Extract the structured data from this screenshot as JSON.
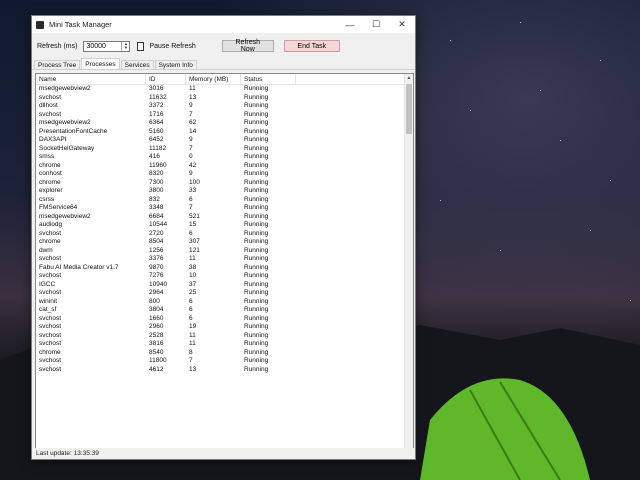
{
  "window": {
    "title": "Mini Task Manager",
    "minimize_glyph": "—",
    "maximize_glyph": "☐",
    "close_glyph": "✕"
  },
  "toolbar": {
    "refresh_label": "Refresh (ms)",
    "refresh_value": "30000",
    "pause_label": "Pause Refresh",
    "refresh_now_label": "Refresh Now",
    "end_task_label": "End Task"
  },
  "tabs": [
    {
      "label": "Process Tree"
    },
    {
      "label": "Processes"
    },
    {
      "label": "Services"
    },
    {
      "label": "System Info"
    }
  ],
  "columns": {
    "name": "Name",
    "id": "ID",
    "memory": "Memory (MB)",
    "status": "Status"
  },
  "rows": [
    {
      "name": "msedgewebview2",
      "id": "3016",
      "memory": "11",
      "status": "Running"
    },
    {
      "name": "svchost",
      "id": "11632",
      "memory": "13",
      "status": "Running"
    },
    {
      "name": "dllhost",
      "id": "3372",
      "memory": "9",
      "status": "Running"
    },
    {
      "name": "svchost",
      "id": "1716",
      "memory": "7",
      "status": "Running"
    },
    {
      "name": "msedgewebview2",
      "id": "6364",
      "memory": "62",
      "status": "Running"
    },
    {
      "name": "PresentationFontCache",
      "id": "5160",
      "memory": "14",
      "status": "Running"
    },
    {
      "name": "DAX3API",
      "id": "6452",
      "memory": "9",
      "status": "Running"
    },
    {
      "name": "SocketHelGateway",
      "id": "11182",
      "memory": "7",
      "status": "Running"
    },
    {
      "name": "smss",
      "id": "416",
      "memory": "0",
      "status": "Running"
    },
    {
      "name": "chrome",
      "id": "11960",
      "memory": "42",
      "status": "Running"
    },
    {
      "name": "conhost",
      "id": "8320",
      "memory": "9",
      "status": "Running"
    },
    {
      "name": "chrome",
      "id": "7300",
      "memory": "100",
      "status": "Running"
    },
    {
      "name": "explorer",
      "id": "3800",
      "memory": "33",
      "status": "Running"
    },
    {
      "name": "csrss",
      "id": "832",
      "memory": "6",
      "status": "Running"
    },
    {
      "name": "FMService64",
      "id": "3348",
      "memory": "7",
      "status": "Running"
    },
    {
      "name": "msedgewebview2",
      "id": "6684",
      "memory": "521",
      "status": "Running"
    },
    {
      "name": "audiodg",
      "id": "10544",
      "memory": "15",
      "status": "Running"
    },
    {
      "name": "svchost",
      "id": "2720",
      "memory": "6",
      "status": "Running"
    },
    {
      "name": "chrome",
      "id": "8504",
      "memory": "307",
      "status": "Running"
    },
    {
      "name": "dwm",
      "id": "1256",
      "memory": "121",
      "status": "Running"
    },
    {
      "name": "svchost",
      "id": "3376",
      "memory": "11",
      "status": "Running"
    },
    {
      "name": "Fabu AI Media Creator v1.7",
      "id": "9870",
      "memory": "38",
      "status": "Running"
    },
    {
      "name": "svchost",
      "id": "7276",
      "memory": "10",
      "status": "Running"
    },
    {
      "name": "IGCC",
      "id": "10940",
      "memory": "37",
      "status": "Running"
    },
    {
      "name": "svchost",
      "id": "2964",
      "memory": "25",
      "status": "Running"
    },
    {
      "name": "wininit",
      "id": "800",
      "memory": "6",
      "status": "Running"
    },
    {
      "name": "cat_sf",
      "id": "3804",
      "memory": "6",
      "status": "Running"
    },
    {
      "name": "svchost",
      "id": "1660",
      "memory": "6",
      "status": "Running"
    },
    {
      "name": "svchost",
      "id": "2960",
      "memory": "19",
      "status": "Running"
    },
    {
      "name": "svchost",
      "id": "2528",
      "memory": "11",
      "status": "Running"
    },
    {
      "name": "svchost",
      "id": "3816",
      "memory": "11",
      "status": "Running"
    },
    {
      "name": "chrome",
      "id": "8540",
      "memory": "8",
      "status": "Running"
    },
    {
      "name": "svchost",
      "id": "11800",
      "memory": "7",
      "status": "Running"
    },
    {
      "name": "svchost",
      "id": "4612",
      "memory": "13",
      "status": "Running"
    }
  ],
  "statusbar": {
    "text": "Last update: 13:35:39"
  }
}
